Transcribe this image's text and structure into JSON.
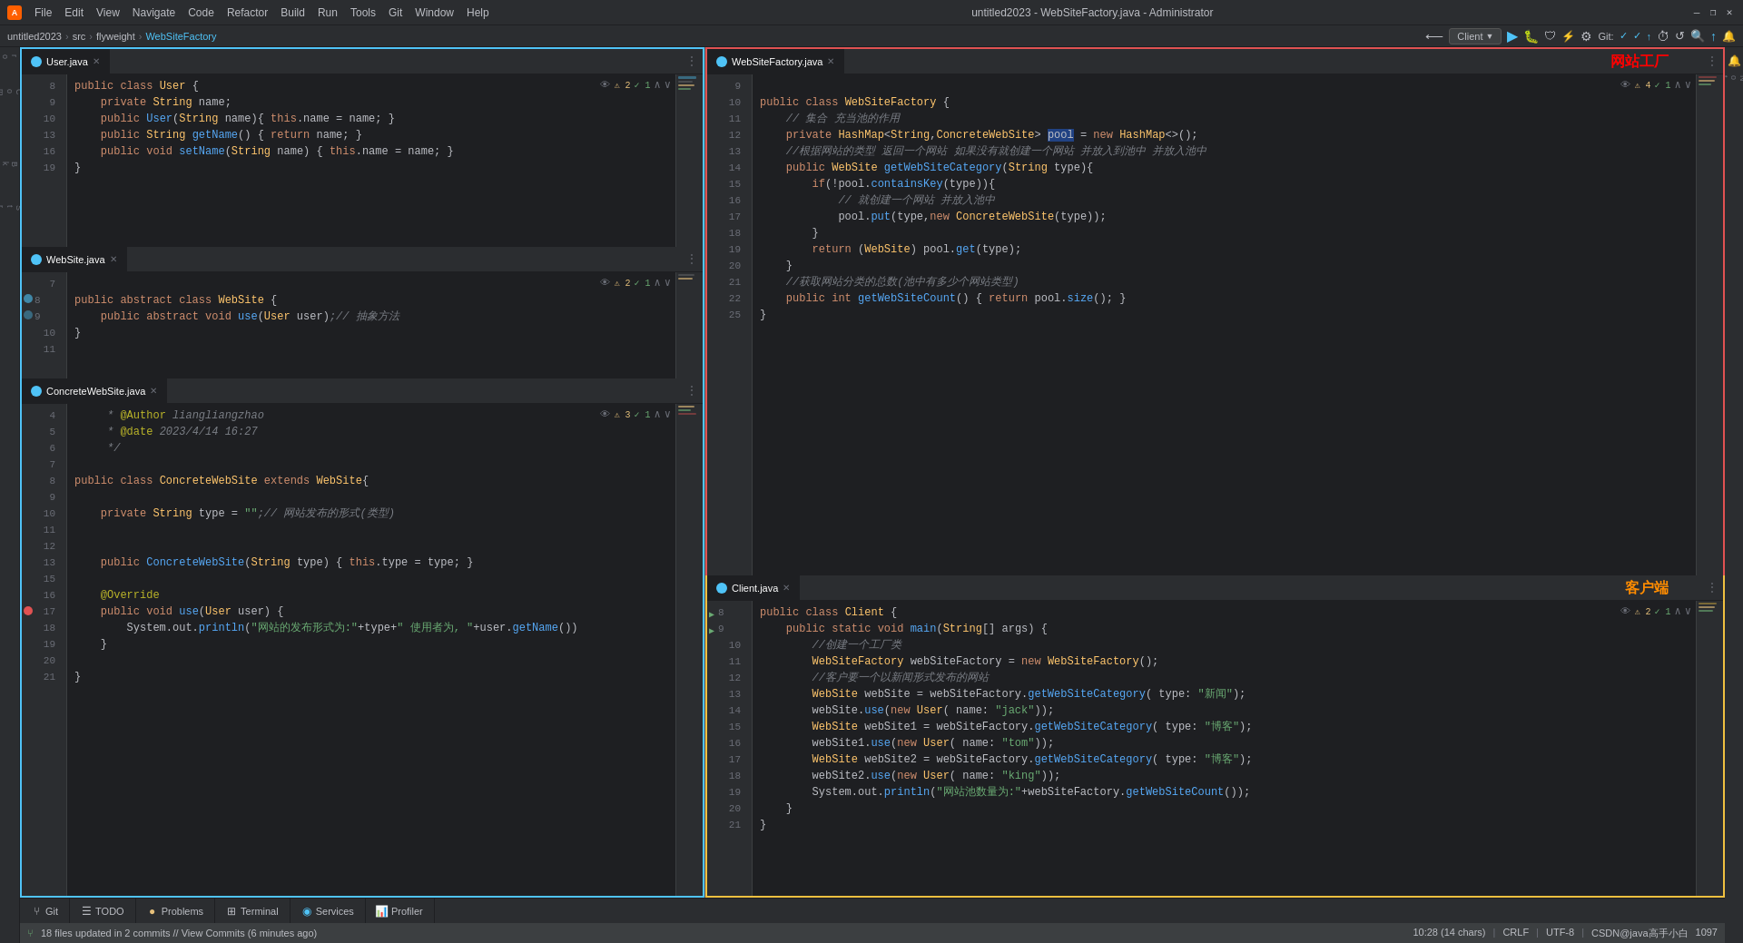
{
  "titleBar": {
    "logo": "A",
    "menus": [
      "File",
      "Edit",
      "View",
      "Navigate",
      "Code",
      "Refactor",
      "Build",
      "Run",
      "Tools",
      "Git",
      "Window",
      "Help"
    ],
    "title": "untitled2023 - WebSiteFactory.java - Administrator",
    "minimize": "—",
    "maximize": "❐",
    "close": "✕"
  },
  "breadcrumb": {
    "parts": [
      "untitled2023",
      "src",
      "flyweight",
      "WebSiteFactory"
    ]
  },
  "toolbar": {
    "clientBtn": "Client",
    "gitLabel": "Git:"
  },
  "tabs": {
    "userJava": "User.java",
    "webSiteJava": "WebSite.java",
    "concreteWebSiteJava": "ConcreteWebSite.java",
    "webSiteFactoryJava": "WebSiteFactory.java",
    "clientJava": "Client.java"
  },
  "chineseLabels": {
    "factory": "网站工厂",
    "client": "客户端"
  },
  "bottomTabs": [
    {
      "id": "git",
      "label": "Git",
      "icon": "⑂"
    },
    {
      "id": "todo",
      "label": "TODO",
      "icon": "☰"
    },
    {
      "id": "problems",
      "label": "Problems",
      "icon": "●"
    },
    {
      "id": "terminal",
      "label": "Terminal",
      "icon": ">_"
    },
    {
      "id": "services",
      "label": "Services",
      "icon": "◉"
    },
    {
      "id": "profiler",
      "label": "Profiler",
      "icon": "📊"
    }
  ],
  "statusBar": {
    "message": "18 files updated in 2 commits // View Commits (6 minutes ago)",
    "position": "10:28 (14 chars)",
    "encoding": "CRLF",
    "charset": "UTF-8",
    "user": "CSDN@java高手小白",
    "lineCount": "1097"
  },
  "code": {
    "user": [
      {
        "ln": "8",
        "text": "    public class User {"
      },
      {
        "ln": "9",
        "text": "        private String name;"
      },
      {
        "ln": "10",
        "text": "        public User(String name){ this.name = name; }"
      },
      {
        "ln": "13",
        "text": "        public String getName() { return name; }"
      },
      {
        "ln": "16",
        "text": "        public void setName(String name) { this.name = name; }"
      },
      {
        "ln": "19",
        "text": "    }"
      }
    ],
    "website": [
      {
        "ln": "7",
        "text": ""
      },
      {
        "ln": "8",
        "text": "    public abstract class WebSite {"
      },
      {
        "ln": "9",
        "text": "        public abstract void use(User user);// 抽象方法"
      },
      {
        "ln": "10",
        "text": "    }"
      },
      {
        "ln": "11",
        "text": ""
      }
    ],
    "concreteWebSite": [
      {
        "ln": "4",
        "text": "     * @Author liangliangzhao"
      },
      {
        "ln": "5",
        "text": "     * @date 2023/4/14 16:27"
      },
      {
        "ln": "6",
        "text": "     */"
      },
      {
        "ln": "7",
        "text": ""
      },
      {
        "ln": "8",
        "text": "    public class ConcreteWebSite extends WebSite{"
      },
      {
        "ln": "9",
        "text": ""
      },
      {
        "ln": "10",
        "text": "        private String type = \"\";// 网站发布的形式(类型)"
      },
      {
        "ln": "11",
        "text": ""
      },
      {
        "ln": "12",
        "text": ""
      },
      {
        "ln": "13",
        "text": "        public ConcreteWebSite(String type) { this.type = type; }"
      },
      {
        "ln": "15",
        "text": ""
      },
      {
        "ln": "16",
        "text": "        @Override"
      },
      {
        "ln": "17",
        "text": "        public void use(User user) {"
      },
      {
        "ln": "18",
        "text": "            System.out.println(\"网站的发布形式为:\"+type+\" 使用者为, \"+user.getName())"
      },
      {
        "ln": "19",
        "text": "        }"
      },
      {
        "ln": "20",
        "text": ""
      },
      {
        "ln": "21",
        "text": "    }"
      }
    ],
    "webSiteFactory": [
      {
        "ln": "9",
        "text": ""
      },
      {
        "ln": "10",
        "text": "    public class WebSiteFactory {"
      },
      {
        "ln": "11",
        "text": "        // 集合 充当池的作用"
      },
      {
        "ln": "12",
        "text": "        private HashMap<String,ConcreteWebSite> pool = new HashMap<>();"
      },
      {
        "ln": "13",
        "text": "        //根据网站的类型 返回一个网站 如果没有就创建一个网站 并放入到池中 并放入池中"
      },
      {
        "ln": "14",
        "text": "        public WebSite getWebSiteCategory(String type){"
      },
      {
        "ln": "15",
        "text": "            if(!pool.containsKey(type)){"
      },
      {
        "ln": "16",
        "text": "                // 就创建一个网站 并放入池中"
      },
      {
        "ln": "17",
        "text": "                pool.put(type,new ConcreteWebSite(type));"
      },
      {
        "ln": "18",
        "text": "            }"
      },
      {
        "ln": "19",
        "text": "            return (WebSite) pool.get(type);"
      },
      {
        "ln": "20",
        "text": "        }"
      },
      {
        "ln": "21",
        "text": "        //获取网站分类的总数(池中有多少个网站类型)"
      },
      {
        "ln": "22",
        "text": "        public int getWebSiteCount() { return pool.size(); }"
      },
      {
        "ln": "25",
        "text": "    }"
      }
    ],
    "client": [
      {
        "ln": "8",
        "text": "    public class Client {"
      },
      {
        "ln": "9",
        "text": "        public static void main(String[] args) {"
      },
      {
        "ln": "10",
        "text": "            //创建一个工厂类"
      },
      {
        "ln": "11",
        "text": "            WebSiteFactory webSiteFactory = new WebSiteFactory();"
      },
      {
        "ln": "12",
        "text": "            //客户要一个以新闻形式发布的网站"
      },
      {
        "ln": "13",
        "text": "            WebSite webSite = webSiteFactory.getWebSiteCategory( type: \"新闻\");"
      },
      {
        "ln": "14",
        "text": "            webSite.use(new User( name: \"jack\"));"
      },
      {
        "ln": "15",
        "text": "            WebSite webSite1 = webSiteFactory.getWebSiteCategory( type: \"博客\");"
      },
      {
        "ln": "16",
        "text": "            webSite1.use(new User( name: \"tom\"));"
      },
      {
        "ln": "17",
        "text": "            WebSite webSite2 = webSiteFactory.getWebSiteCategory( type: \"博客\");"
      },
      {
        "ln": "18",
        "text": "            webSite2.use(new User( name: \"king\"));"
      },
      {
        "ln": "19",
        "text": "            System.out.println(\"网站池数量为:\"+webSiteFactory.getWebSiteCount());"
      },
      {
        "ln": "20",
        "text": "        }"
      },
      {
        "ln": "21",
        "text": "    }"
      }
    ]
  }
}
